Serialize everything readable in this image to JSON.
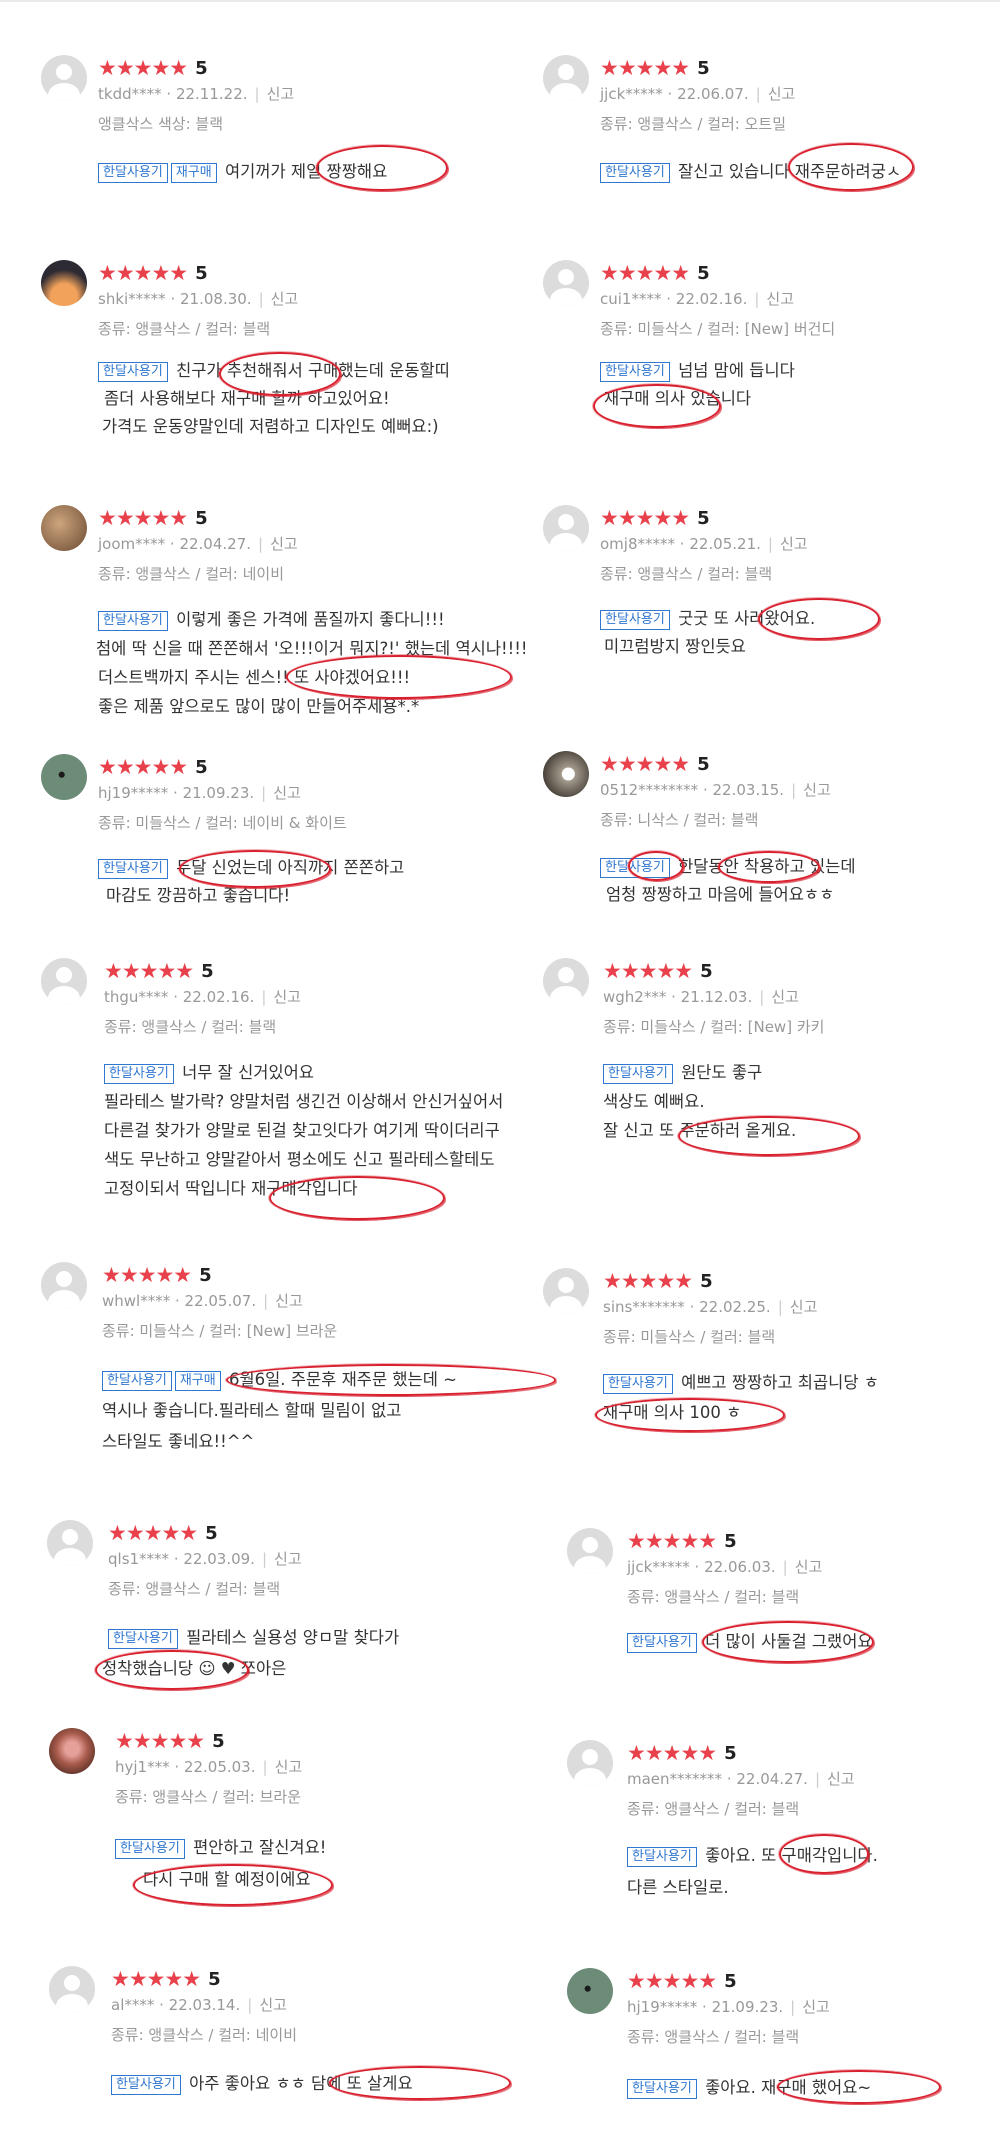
{
  "rating_stars": "★★★★★",
  "report_label": "신고",
  "badges": {
    "monthly": "한달사용기",
    "repurchase": "재구매"
  },
  "accent_colors": {
    "star": "#e8414b",
    "badge": "#2f77d0",
    "highlight_circle": "#d8202e"
  },
  "reviews": [
    {
      "score": "5",
      "user": "tkdd****",
      "date": "22.11.22.",
      "option": "앵클삭스 색상: 블랙",
      "lines": [
        "여기꺼가 제일 짱짱해요"
      ]
    },
    {
      "score": "5",
      "user": "jjck*****",
      "date": "22.06.07.",
      "option": "종류: 앵클삭스 / 컬러: 오트밀",
      "lines": [
        "잘신고 있습니다 재주문하려궁ㅅ"
      ]
    },
    {
      "score": "5",
      "user": "shki*****",
      "date": "21.08.30.",
      "option": "종류: 앵클삭스 / 컬러: 블랙",
      "lines": [
        "친구가 추천해줘서 구매했는데 운동할띠",
        "좀더 사용해보다 재구매 할까 하고있어요!",
        "가격도 운동양말인데 저렴하고 디자인도 예뻐요:)"
      ]
    },
    {
      "score": "5",
      "user": "cui1****",
      "date": "22.02.16.",
      "option": "종류: 미들삭스 / 컬러: [New] 버건디",
      "lines": [
        "넘넘 맘에 듭니다",
        "재구매 의사 있습니다"
      ]
    },
    {
      "score": "5",
      "user": "joom****",
      "date": "22.04.27.",
      "option": "종류: 앵클삭스 / 컬러: 네이비",
      "lines": [
        "이렇게 좋은 가격에 품질까지 좋다니!!!",
        "첨에 딱 신을 때 쫀쫀해서 '오!!!이거 뭐지?!' 했는데 역시나!!!!",
        "더스트백까지 주시는 센스!! 또 사야겠어요!!!",
        "좋은 제품 앞으로도 많이 많이 만들어주세용*.*"
      ]
    },
    {
      "score": "5",
      "user": "omj8*****",
      "date": "22.05.21.",
      "option": "종류: 앵클삭스 / 컬러: 블랙",
      "lines": [
        "굿굿 또 사러왔어요.",
        "미끄럼방지 짱인듯요"
      ]
    },
    {
      "score": "5",
      "user": "hj19*****",
      "date": "21.09.23.",
      "option": "종류: 미들삭스 / 컬러: 네이비 & 화이트",
      "lines": [
        "두달 신었는데 아직까지 쫀쫀하고",
        "마감도 깡끔하고 좋습니다!"
      ]
    },
    {
      "score": "5",
      "user": "0512********",
      "date": "22.03.15.",
      "option": "종류: 니삭스 / 컬러: 블랙",
      "lines": [
        "한달동안 착용하고 있는데",
        "엄청 짱짱하고 마음에 들어요ㅎㅎ"
      ]
    },
    {
      "score": "5",
      "user": "thgu****",
      "date": "22.02.16.",
      "option": "종류: 앵클삭스 / 컬러: 블랙",
      "lines": [
        "너무 잘 신거있어요",
        "필라테스 발가락? 양말처럼 생긴건 이상해서 안신거싶어서",
        "다른걸 찾가가 양말로 된걸 찾고잇다가 여기게 딱이더리구",
        "색도 무난하고 양말같아서 평소에도 신고 필라테스할테도",
        "고정이되서 딱입니다 재구매각입니다"
      ]
    },
    {
      "score": "5",
      "user": "wgh2***",
      "date": "21.12.03.",
      "option": "종류: 미들삭스 / 컬러: [New] 카키",
      "lines": [
        "원단도 좋구",
        "색상도 예뻐요.",
        "잘 신고 또 주문하러 올게요."
      ]
    },
    {
      "score": "5",
      "user": "whwl****",
      "date": "22.05.07.",
      "option": "종류: 미들삭스 / 컬러: [New] 브라운",
      "lines": [
        "6월6일. 주문후 재주문 했는데 ~",
        "역시나 좋습니다.필라테스 할때 밀림이 없고",
        "스타일도 좋네요!!^^"
      ]
    },
    {
      "score": "5",
      "user": "sins*******",
      "date": "22.02.25.",
      "option": "종류: 미들삭스 / 컬러: 블랙",
      "lines": [
        "예쁘고 짱짱하고 최곱니당 ㅎ",
        "재구매 의사 100 ㅎ"
      ]
    },
    {
      "score": "5",
      "user": "qls1****",
      "date": "22.03.09.",
      "option": "종류: 앵클삭스 / 컬러: 블랙",
      "lines": [
        "필라테스 실용성 양ㅁ말 찾다가",
        "정착했습니당 ☺ ♥ 쪼아은"
      ]
    },
    {
      "score": "5",
      "user": "jjck*****",
      "date": "22.06.03.",
      "option": "종류: 앵클삭스 / 컬러: 블랙",
      "lines": [
        "더 많이 사둘걸 그랬어요"
      ]
    },
    {
      "score": "5",
      "user": "hyj1***",
      "date": "22.05.03.",
      "option": "종류: 앵클삭스 / 컬러: 브라운",
      "lines": [
        "편안하고 잘신겨요!",
        "다시 구매 할 예정이에요"
      ]
    },
    {
      "score": "5",
      "user": "maen*******",
      "date": "22.04.27.",
      "option": "종류: 앵클삭스 / 컬러: 블랙",
      "lines": [
        "좋아요. 또 구매각입니다.",
        "다른 스타일로."
      ]
    },
    {
      "score": "5",
      "user": "al****",
      "date": "22.03.14.",
      "option": "종류: 앵클삭스 / 컬러: 네이비",
      "lines": [
        "아주 좋아요 ㅎㅎ 담에 또 살게요"
      ]
    },
    {
      "score": "5",
      "user": "hj19*****",
      "date": "21.09.23.",
      "option": "종류: 앵클삭스 / 컬러: 블랙",
      "lines": [
        "좋아요. 재구매 했어요~"
      ]
    }
  ]
}
